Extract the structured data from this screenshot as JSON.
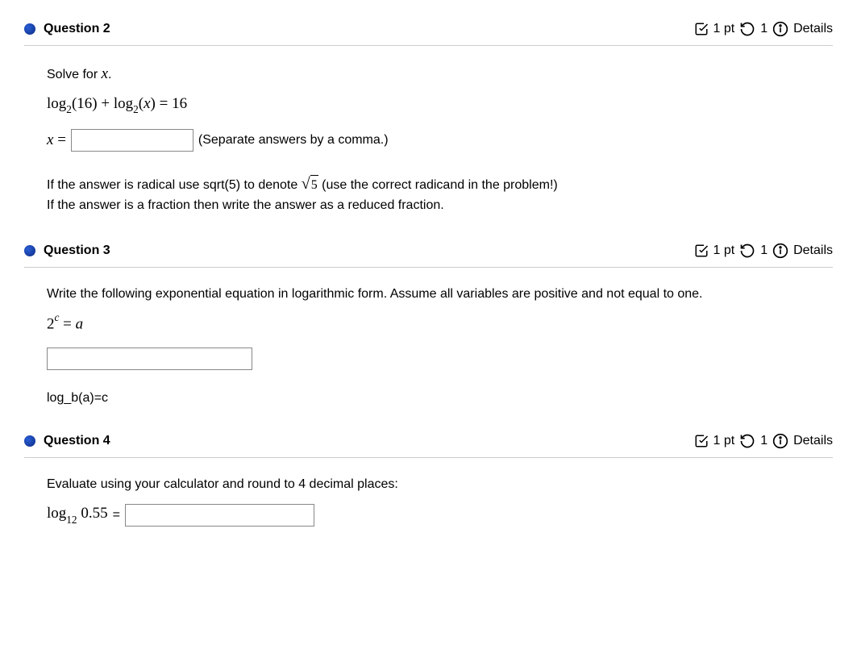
{
  "questions": [
    {
      "title": "Question 2",
      "points_label": "1 pt",
      "retry_count": "1",
      "details_label": "Details",
      "prompt": "Solve for",
      "prompt_var": "x",
      "equation": {
        "log1_base": "2",
        "log1_arg": "16",
        "plus": "+",
        "log2_base": "2",
        "log2_arg": "x",
        "equals_rhs": "16"
      },
      "answer_prefix_var": "x",
      "answer_equals": "=",
      "separate_hint": "(Separate answers by a comma.)",
      "note_line1_a": "If the answer is radical use sqrt(5) to denote ",
      "note_sqrt_val": "5",
      "note_line1_b": " (use the correct radicand in the problem!)",
      "note_line2": "If the answer is a fraction then write the answer as a reduced fraction."
    },
    {
      "title": "Question 3",
      "points_label": "1 pt",
      "retry_count": "1",
      "details_label": "Details",
      "prompt": "Write the following exponential equation in logarithmic form. Assume all variables are positive and not equal to one.",
      "equation": {
        "base": "2",
        "exp": "c",
        "equals": "=",
        "rhs": "a"
      },
      "hint_below": "log_b(a)=c"
    },
    {
      "title": "Question 4",
      "points_label": "1 pt",
      "retry_count": "1",
      "details_label": "Details",
      "prompt": "Evaluate using your calculator and round to 4 decimal places:",
      "equation": {
        "log_word": "log",
        "base": "12",
        "arg": "0.55",
        "equals": "="
      }
    }
  ]
}
